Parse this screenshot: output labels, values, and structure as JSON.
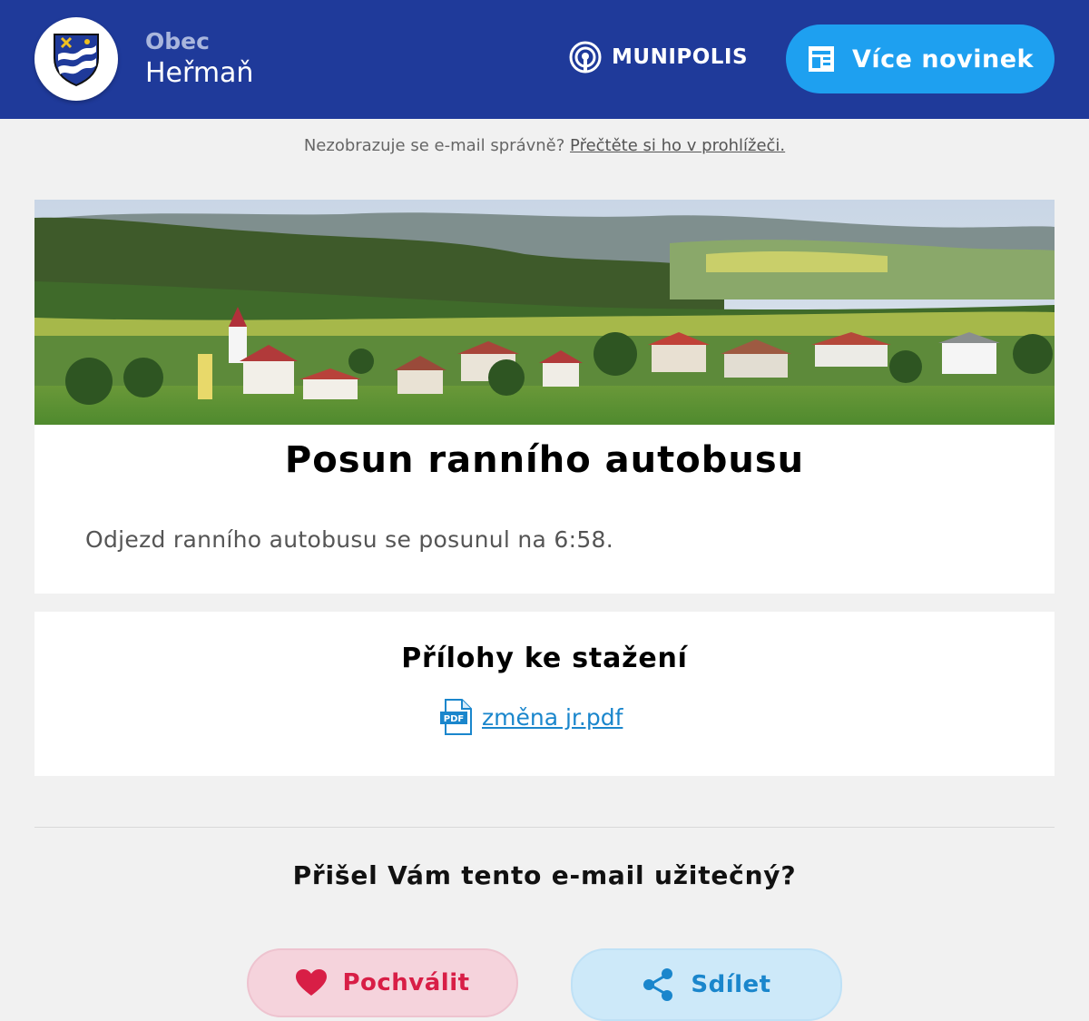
{
  "header": {
    "brand_line1": "Obec",
    "brand_line2": "Heřmaň",
    "provider": "MUNIPOLIS",
    "more_news_label": "Více novinek"
  },
  "notice": {
    "text": "Nezobrazuje se e-mail správně?",
    "link_label": "Přečtěte si ho v prohlížeči."
  },
  "article": {
    "title": "Posun ranního autobusu",
    "body": "Odjezd ranního autobusu se posunul na 6:58."
  },
  "attachments": {
    "title": "Přílohy ke stažení",
    "files": [
      {
        "name": "změna jr.pdf",
        "icon": "pdf-file-icon"
      }
    ]
  },
  "feedback": {
    "question": "Přišel Vám tento e-mail užitečný?",
    "praise_label": "Pochválit",
    "share_label": "Sdílet"
  },
  "colors": {
    "header_bg": "#1f3a9a",
    "accent_blue": "#1ea0f0",
    "praise_red": "#d81e46",
    "link_blue": "#1a86cc"
  }
}
